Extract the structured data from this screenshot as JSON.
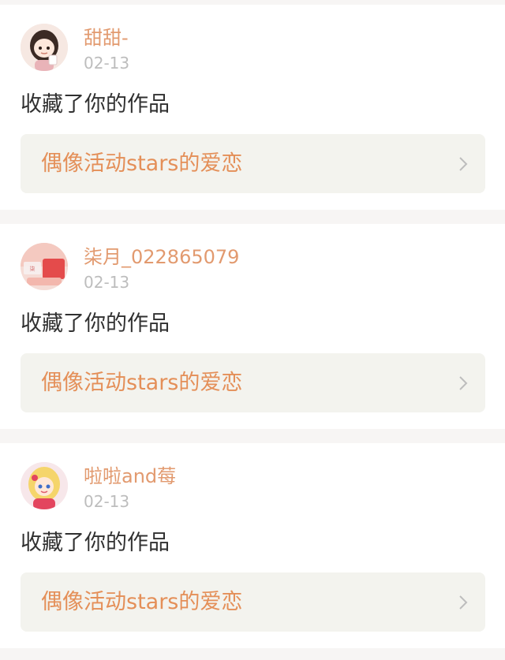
{
  "notifications": [
    {
      "username": "甜甜-",
      "date": "02-13",
      "action": "收藏了你的作品",
      "work_title": "偶像活动stars的爱恋",
      "avatar_icon": "anime-girl-avatar-icon"
    },
    {
      "username": "柒月_022865079",
      "date": "02-13",
      "action": "收藏了你的作品",
      "work_title": "偶像活动stars的爱恋",
      "avatar_icon": "red-photo-avatar-icon"
    },
    {
      "username": "啦啦and莓",
      "date": "02-13",
      "action": "收藏了你的作品",
      "work_title": "偶像活动stars的爱恋",
      "avatar_icon": "blonde-anime-girl-avatar-icon"
    }
  ],
  "colors": {
    "username": "#e29a6f",
    "work_title": "#e48f58",
    "background": "#f7f5f4",
    "card": "#ffffff",
    "work_link_bg": "#f3f3ee"
  },
  "icons": {
    "chevron": "chevron-right-icon"
  }
}
